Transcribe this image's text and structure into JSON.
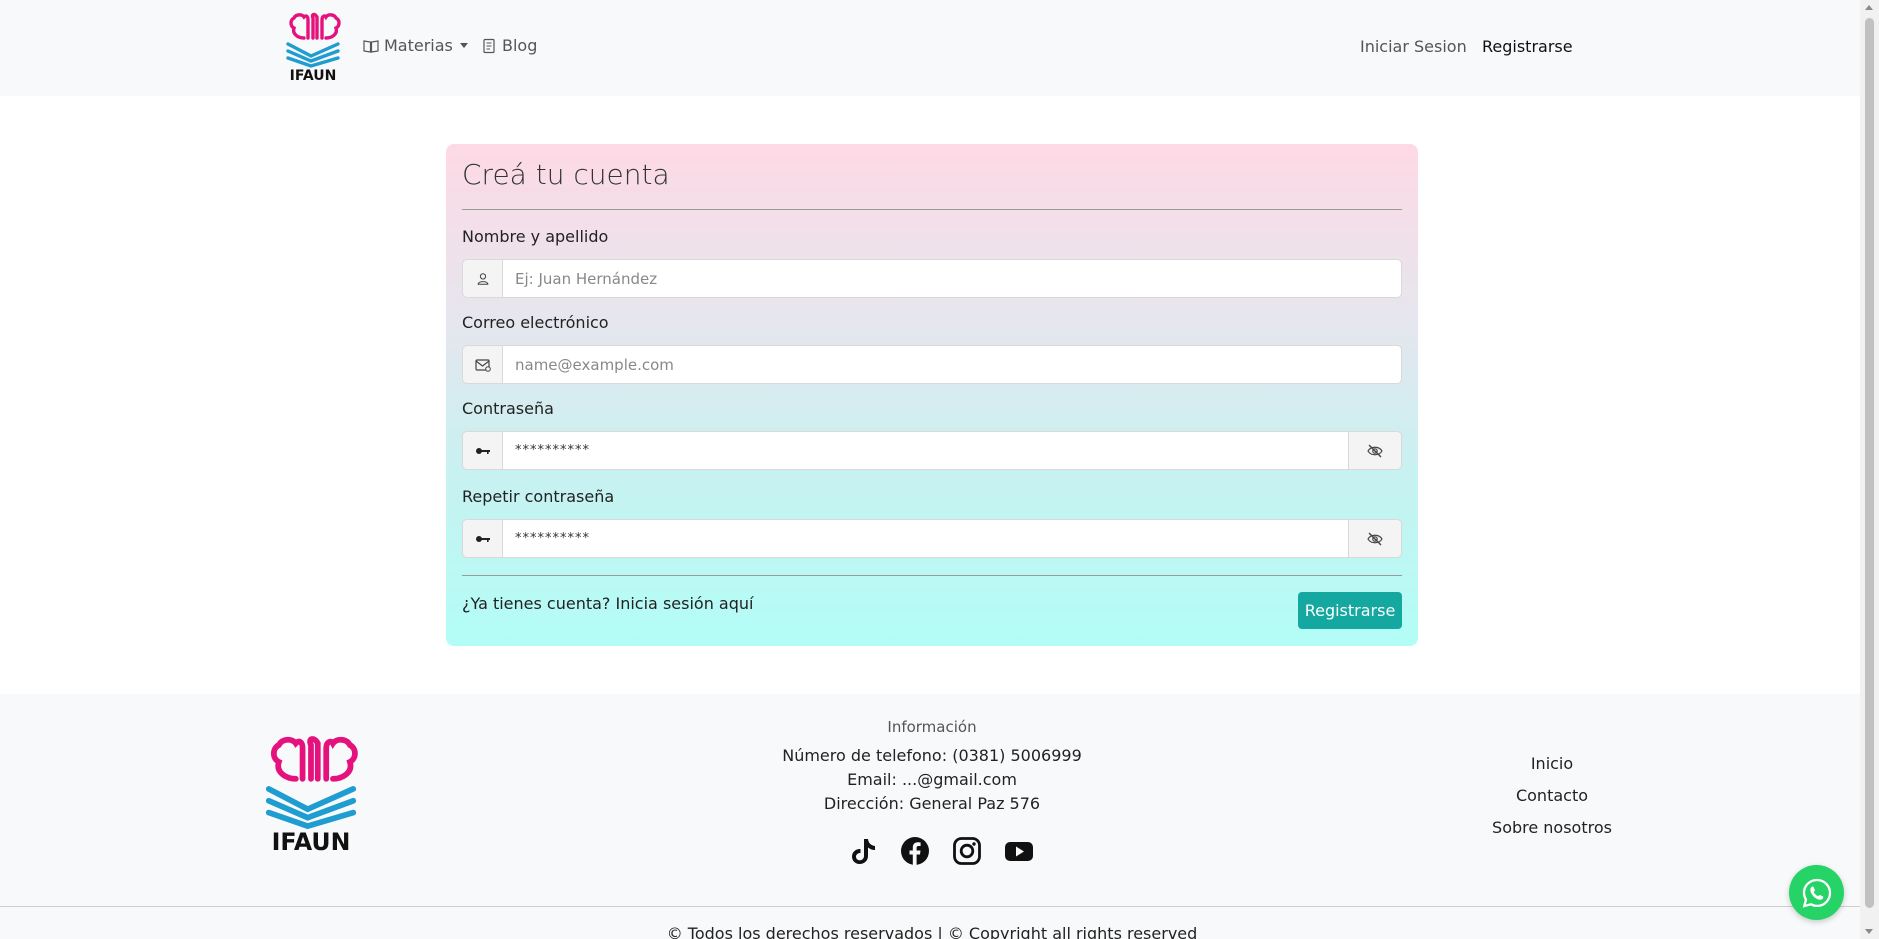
{
  "colors": {
    "brand_pink": "#e5127d",
    "brand_blue": "#1f9cd0",
    "accent_teal": "#14a8a0",
    "whatsapp": "#25d366"
  },
  "navbar": {
    "logo_text": "IFAUN",
    "links": [
      {
        "label": "Materias",
        "icon": "book-icon",
        "has_dropdown": true
      },
      {
        "label": "Blog",
        "icon": "document-icon"
      }
    ],
    "login": "Iniciar Sesion",
    "register": "Registrarse"
  },
  "form": {
    "title": "Creá tu cuenta",
    "fields": [
      {
        "label": "Nombre y apellido",
        "placeholder": "Ej: Juan Hernández",
        "icon": "person-icon"
      },
      {
        "label": "Correo electrónico",
        "placeholder": "name@example.com",
        "icon": "envelope-icon"
      },
      {
        "label": "Contraseña",
        "value": "**********",
        "icon": "key-icon",
        "toggle_icon": "eye-slash-icon"
      },
      {
        "label": "Repetir contraseña",
        "value": "**********",
        "icon": "key-icon",
        "toggle_icon": "eye-slash-icon"
      }
    ],
    "login_prompt": "¿Ya tienes cuenta? Inicia sesión aquí",
    "submit": "Registrarse"
  },
  "footer": {
    "logo_text": "IFAUN",
    "info_title": "Información",
    "phone": "Número de telefono: (0381) 5006999",
    "email": "Email: ...@gmail.com",
    "address": "Dirección: General Paz 576",
    "socials": [
      "tiktok-icon",
      "facebook-icon",
      "instagram-icon",
      "youtube-icon"
    ],
    "links": [
      "Inicio",
      "Contacto",
      "Sobre nosotros"
    ],
    "copyright": "© Todos los derechos reservados | © Copyright all rights reserved"
  }
}
